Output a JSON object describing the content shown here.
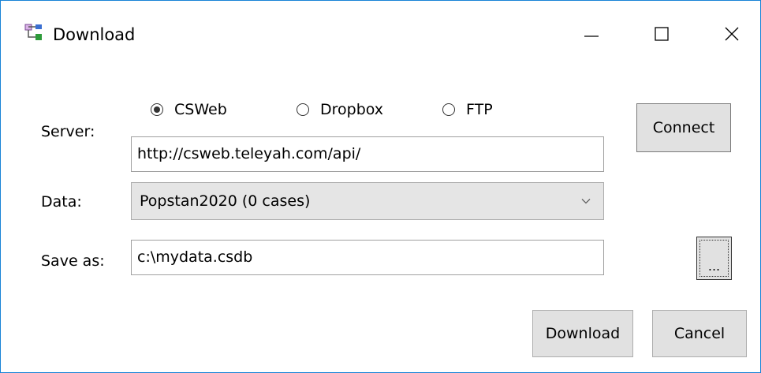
{
  "window": {
    "title": "Download",
    "icon": "tree-structure-icon"
  },
  "controls": {
    "minimize_icon": "minimize-icon",
    "maximize_icon": "maximize-icon",
    "close_icon": "close-icon"
  },
  "server": {
    "label": "Server:",
    "options": [
      {
        "label": "CSWeb",
        "selected": true
      },
      {
        "label": "Dropbox",
        "selected": false
      },
      {
        "label": "FTP",
        "selected": false
      }
    ],
    "url": "http://csweb.teleyah.com/api/",
    "connect_label": "Connect"
  },
  "data": {
    "label": "Data:",
    "selected": "Popstan2020 (0 cases)"
  },
  "save": {
    "label": "Save as:",
    "path": "c:\\mydata.csdb",
    "browse_label": "..."
  },
  "footer": {
    "download_label": "Download",
    "cancel_label": "Cancel"
  },
  "colors": {
    "window_border": "#1883d7",
    "button_bg": "#e1e1e1",
    "combo_bg": "#e5e5e5"
  }
}
